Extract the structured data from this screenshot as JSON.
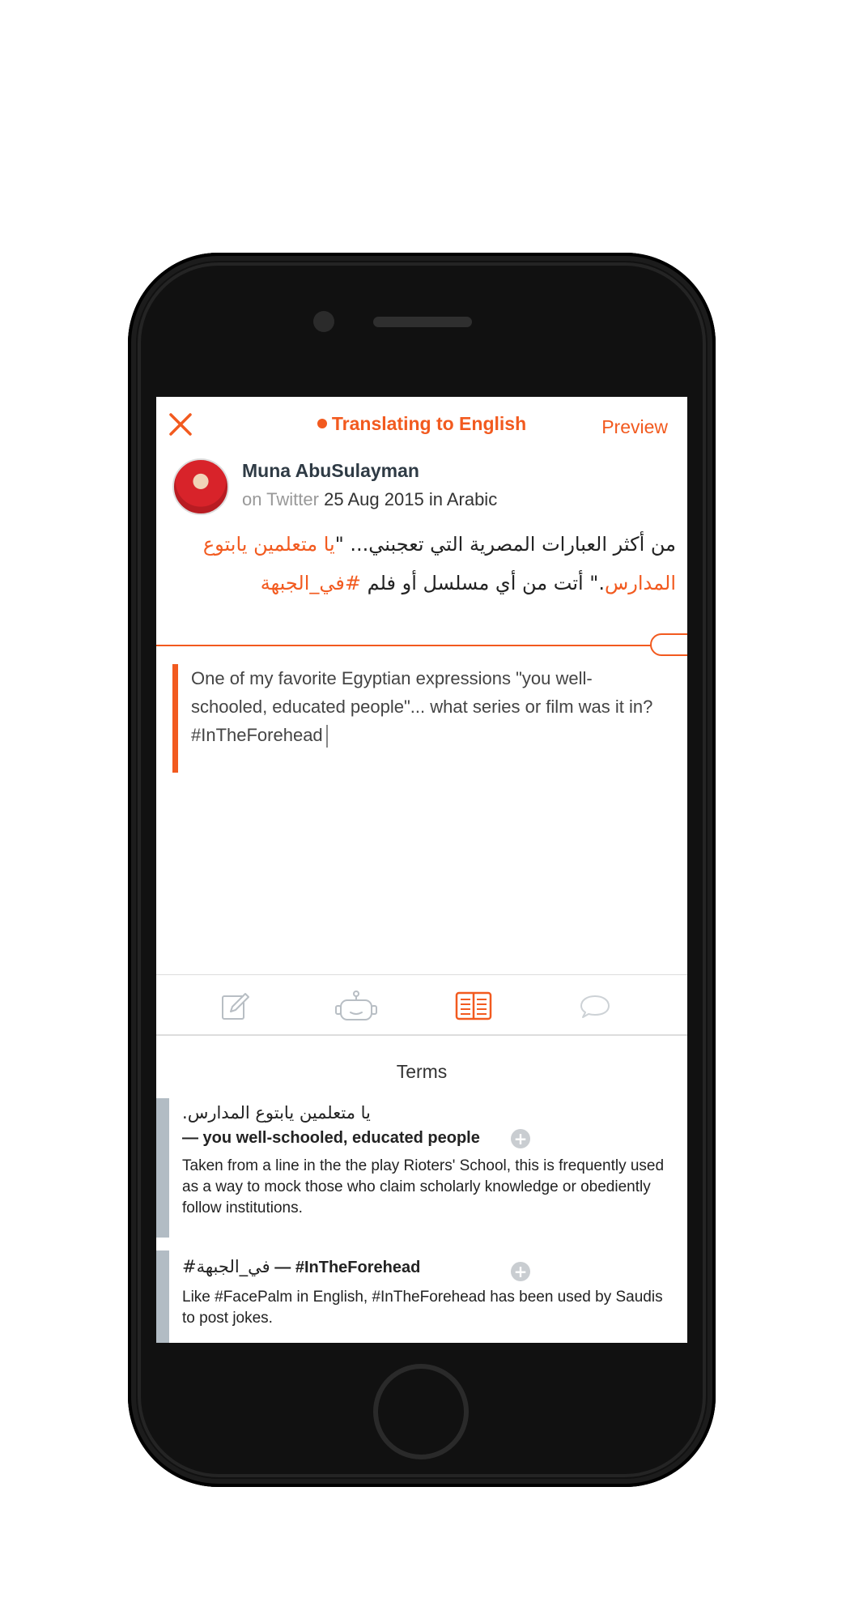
{
  "header": {
    "title": "Translating to English",
    "preview_label": "Preview",
    "accent_color": "#f25a1f",
    "close_icon": "close-icon"
  },
  "author": {
    "name": "Muna AbuSulayman",
    "platform": "on Twitter",
    "date": "25 Aug 2015",
    "language": "in Arabic"
  },
  "source_text": {
    "part1": "من أكثر العبارات المصرية التي تعجبني... \"",
    "highlight1": "يا متعلمين يابتوع المدارس",
    "part2": ".\" أتت من أي مسلسل أو فلم ",
    "highlight2": "#في_الجبهة"
  },
  "translation": {
    "text": "One of my favorite Egyptian expressions \"you well-schooled, educated people\"...  what series or film was it in? #InTheForehead"
  },
  "tabs": [
    {
      "icon": "edit-icon",
      "active": false
    },
    {
      "icon": "robot-icon",
      "active": false
    },
    {
      "icon": "book-icon",
      "active": true
    },
    {
      "icon": "comment-icon",
      "active": false
    }
  ],
  "terms": {
    "title": "Terms",
    "items": [
      {
        "source": ".يا متعلمين يابتوع المدارس",
        "translation": "— you well-schooled, educated people",
        "description": "Taken from a line in the the play Rioters' School, this is frequently used as a way to mock those who claim scholarly knowledge or obediently follow institutions."
      },
      {
        "source": "#في_الجبهة",
        "translation": " —  #InTheForehead",
        "description": "Like #FacePalm in English, #InTheForehead has been used by Saudis to post jokes."
      }
    ]
  }
}
